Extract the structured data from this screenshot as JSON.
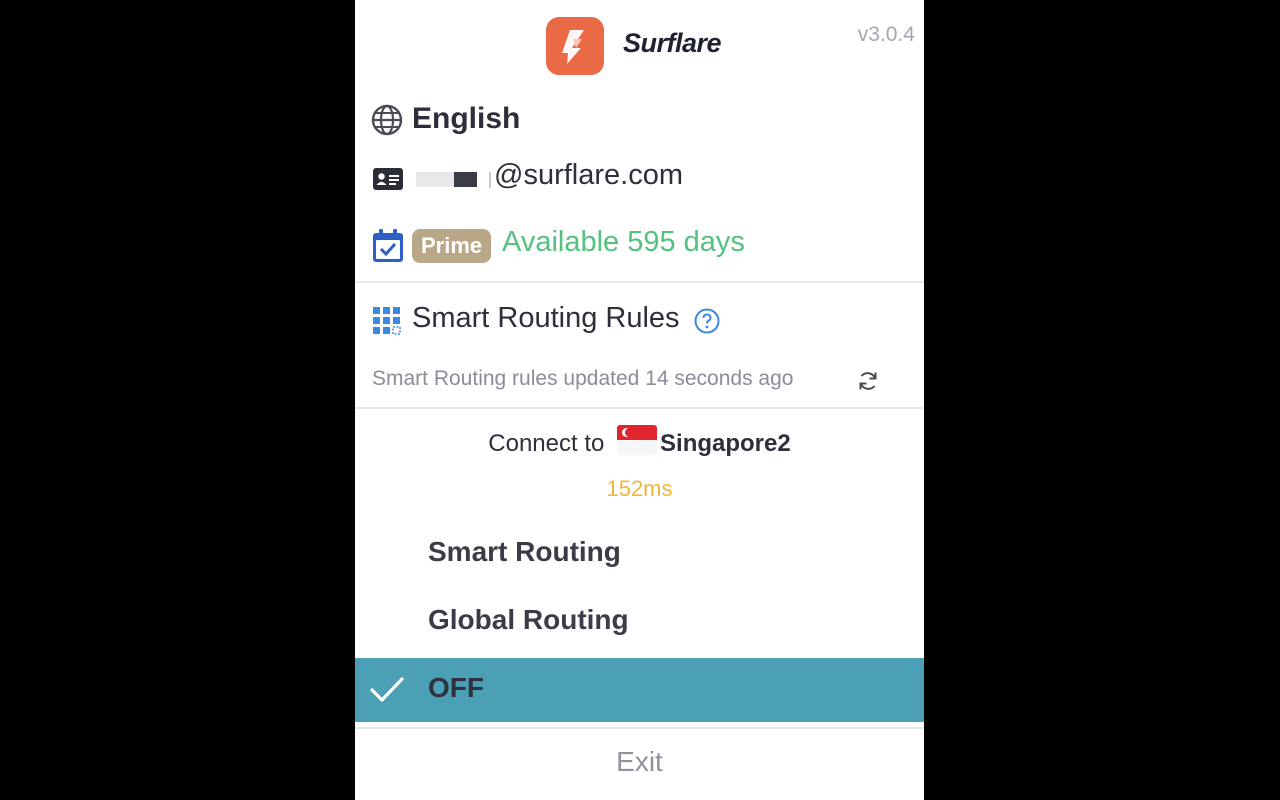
{
  "app": {
    "brand": "Surflare",
    "version": "v3.0.4"
  },
  "account": {
    "language": "English",
    "email_domain": "@surflare.com",
    "plan_badge": "Prime",
    "availability": "Available 595 days"
  },
  "rules": {
    "title": "Smart Routing Rules",
    "updated_text": "Smart Routing rules updated 14 seconds ago"
  },
  "connection": {
    "prefix": "Connect to",
    "server": "Singapore2",
    "latency": "152ms"
  },
  "menu": {
    "items": [
      {
        "label": "Smart Routing",
        "selected": false
      },
      {
        "label": "Global Routing",
        "selected": false
      },
      {
        "label": "OFF",
        "selected": true
      }
    ],
    "exit_label": "Exit"
  },
  "colors": {
    "accent_selected": "#4ba0b6",
    "availability_green": "#54c17f",
    "latency_yellow": "#f3b63a",
    "badge_tan": "#b9a888",
    "logo_orange": "#ea6a45"
  },
  "icons": {
    "language": "globe-icon",
    "account": "id-card-icon",
    "plan": "calendar-check-icon",
    "rules": "grid-icon",
    "help": "help-circle-icon",
    "refresh": "refresh-icon",
    "selected": "checkmark-icon"
  }
}
